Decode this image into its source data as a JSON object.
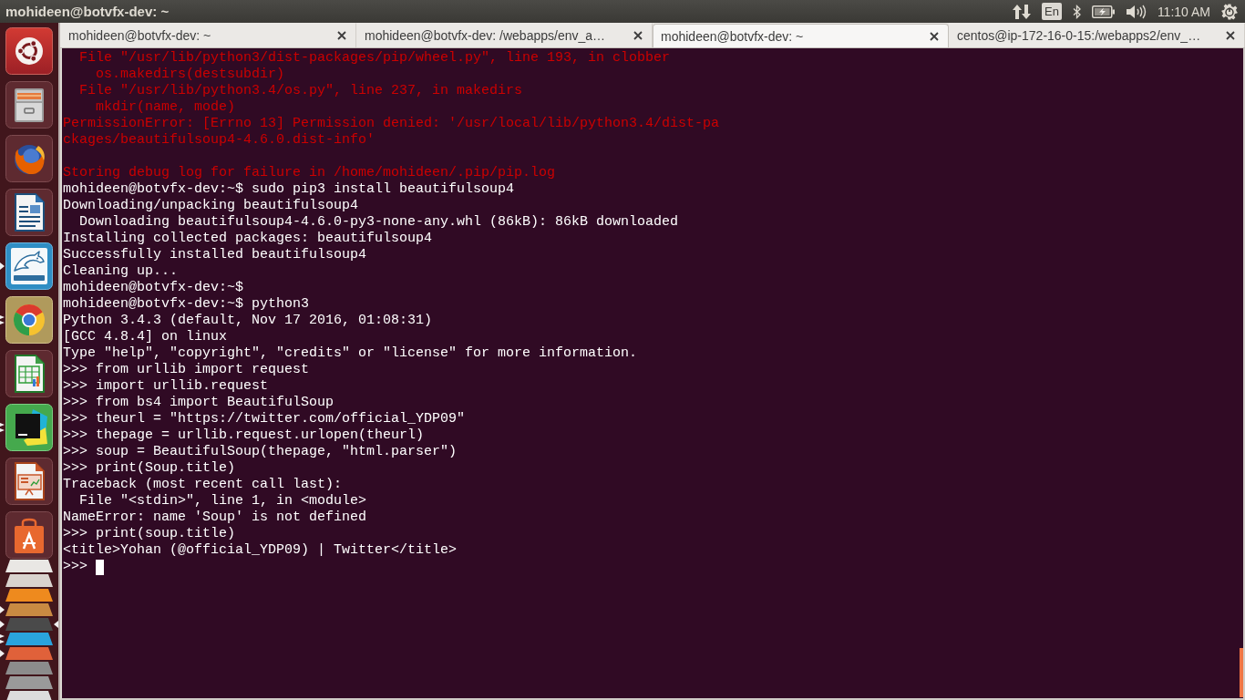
{
  "top_panel": {
    "window_title": "mohideen@botvfx-dev: ~",
    "keyboard_layout": "En",
    "clock": "11:10 AM"
  },
  "launcher": {
    "items": [
      {
        "kind": "logo",
        "running": false,
        "multiple_windows": false,
        "active": false
      },
      {
        "kind": "cabinet",
        "running": false,
        "multiple_windows": false,
        "active": false
      },
      {
        "kind": "fox",
        "running": false,
        "multiple_windows": false,
        "active": false
      },
      {
        "kind": "document",
        "running": false,
        "multiple_windows": false,
        "active": false
      },
      {
        "kind": "dolphin",
        "running": true,
        "multiple_windows": false,
        "active": false
      },
      {
        "kind": "wheel",
        "running": true,
        "multiple_windows": true,
        "active": false
      },
      {
        "kind": "spreadsheet",
        "running": false,
        "multiple_windows": false,
        "active": false
      },
      {
        "kind": "ide",
        "running": true,
        "multiple_windows": true,
        "active": false
      },
      {
        "kind": "slides",
        "running": false,
        "multiple_windows": false,
        "active": false
      },
      {
        "kind": "bag",
        "running": false,
        "multiple_windows": false,
        "active": false
      },
      {
        "kind": "folded",
        "color": "#e9e7e4",
        "running": false,
        "multiple_windows": false,
        "active": false
      },
      {
        "kind": "folded",
        "color": "#d9d3ce",
        "running": false,
        "multiple_windows": false,
        "active": false
      },
      {
        "kind": "folded",
        "color": "#ee8a1e",
        "running": false,
        "multiple_windows": false,
        "active": false
      },
      {
        "kind": "folded",
        "color": "#c98a42",
        "running": true,
        "multiple_windows": false,
        "active": false
      },
      {
        "kind": "folded",
        "color": "#4a4a4a",
        "running": true,
        "multiple_windows": false,
        "active": true
      },
      {
        "kind": "folded",
        "color": "#2aa3dd",
        "running": true,
        "multiple_windows": true,
        "active": false
      },
      {
        "kind": "folded",
        "color": "#e0613a",
        "running": true,
        "multiple_windows": false,
        "active": false
      },
      {
        "kind": "folded",
        "color": "#8c8c8c",
        "running": false,
        "multiple_windows": false,
        "active": false
      },
      {
        "kind": "folded",
        "color": "#9a9a9a",
        "running": false,
        "multiple_windows": false,
        "active": false
      },
      {
        "kind": "folded",
        "color": "#dcdcdc",
        "running": false,
        "multiple_windows": false,
        "active": false
      }
    ]
  },
  "terminal": {
    "tabs": [
      {
        "label": "mohideen@botvfx-dev: ~",
        "selected": false
      },
      {
        "label": "mohideen@botvfx-dev: /webapps/env_a…",
        "selected": false
      },
      {
        "label": "mohideen@botvfx-dev: ~",
        "selected": true
      },
      {
        "label": "centos@ip-172-16-0-15:/webapps2/env_…",
        "selected": false
      }
    ],
    "lines": [
      {
        "kind": "error",
        "text": "  File \"/usr/lib/python3/dist-packages/pip/wheel.py\", line 193, in clobber"
      },
      {
        "kind": "error",
        "text": "    os.makedirs(destsubdir)"
      },
      {
        "kind": "error",
        "text": "  File \"/usr/lib/python3.4/os.py\", line 237, in makedirs"
      },
      {
        "kind": "error",
        "text": "    mkdir(name, mode)"
      },
      {
        "kind": "error",
        "text": "PermissionError: [Errno 13] Permission denied: '/usr/local/lib/python3.4/dist-pa"
      },
      {
        "kind": "error",
        "text": "ckages/beautifulsoup4-4.6.0.dist-info'"
      },
      {
        "kind": "blank"
      },
      {
        "kind": "error",
        "text": "Storing debug log for failure in /home/mohideen/.pip/pip.log"
      },
      {
        "kind": "output",
        "text": "mohideen@botvfx-dev:~$ sudo pip3 install beautifulsoup4"
      },
      {
        "kind": "output",
        "text": "Downloading/unpacking beautifulsoup4"
      },
      {
        "kind": "output",
        "text": "  Downloading beautifulsoup4-4.6.0-py3-none-any.whl (86kB): 86kB downloaded"
      },
      {
        "kind": "output",
        "text": "Installing collected packages: beautifulsoup4"
      },
      {
        "kind": "output",
        "text": "Successfully installed beautifulsoup4"
      },
      {
        "kind": "output",
        "text": "Cleaning up..."
      },
      {
        "kind": "output",
        "text": "mohideen@botvfx-dev:~$"
      },
      {
        "kind": "output",
        "text": "mohideen@botvfx-dev:~$ python3"
      },
      {
        "kind": "output",
        "text": "Python 3.4.3 (default, Nov 17 2016, 01:08:31)"
      },
      {
        "kind": "output",
        "text": "[GCC 4.8.4] on linux"
      },
      {
        "kind": "output",
        "text": "Type \"help\", \"copyright\", \"credits\" or \"license\" for more information."
      },
      {
        "kind": "output",
        "text": ">>> from urllib import request"
      },
      {
        "kind": "output",
        "text": ">>> import urllib.request"
      },
      {
        "kind": "output",
        "text": ">>> from bs4 import BeautifulSoup"
      },
      {
        "kind": "output",
        "text": ">>> theurl = \"https://twitter.com/official_YDP09\""
      },
      {
        "kind": "output",
        "text": ">>> thepage = urllib.request.urlopen(theurl)"
      },
      {
        "kind": "output",
        "text": ">>> soup = BeautifulSoup(thepage, \"html.parser\")"
      },
      {
        "kind": "output",
        "text": ">>> print(Soup.title)"
      },
      {
        "kind": "output",
        "text": "Traceback (most recent call last):"
      },
      {
        "kind": "output",
        "text": "  File \"<stdin>\", line 1, in <module>"
      },
      {
        "kind": "output",
        "text": "NameError: name 'Soup' is not defined"
      },
      {
        "kind": "output",
        "text": ">>> print(soup.title)"
      },
      {
        "kind": "output",
        "text": "<title>Yohan (@official_YDP09) | Twitter</title>"
      }
    ],
    "prompt": ">>>"
  }
}
